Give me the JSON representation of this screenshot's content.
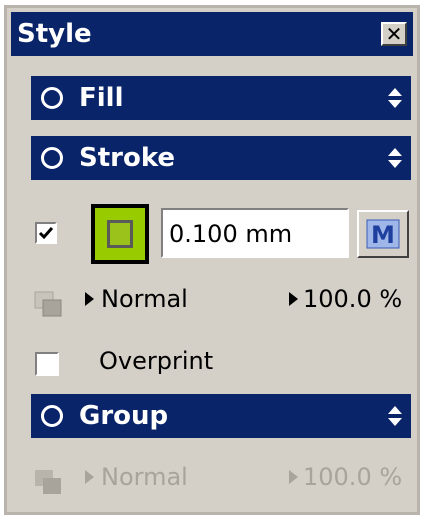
{
  "window": {
    "title": "Style",
    "close_label": "✕"
  },
  "sections": {
    "fill": {
      "label": "Fill"
    },
    "stroke": {
      "label": "Stroke"
    },
    "group": {
      "label": "Group"
    }
  },
  "stroke_controls": {
    "enabled_checked": true,
    "width_value": "0.100 mm",
    "blend_mode": "Normal",
    "opacity": "100.0 %",
    "overprint_label": "Overprint",
    "overprint_checked": false,
    "swatch_color": "#99cc00",
    "m_button_label": "M"
  },
  "group_controls": {
    "blend_mode": "Normal",
    "opacity": "100.0 %"
  },
  "colors": {
    "titlebar": "#0a246a",
    "panel_bg": "#d4d0c8",
    "disabled_text": "#a8a49c"
  },
  "icons": {
    "section_radio": "radio-circle-icon",
    "section_spinner": "up-down-arrows-icon",
    "blend": "blend-squares-icon",
    "menu_triangle": "triangle-right-icon"
  }
}
